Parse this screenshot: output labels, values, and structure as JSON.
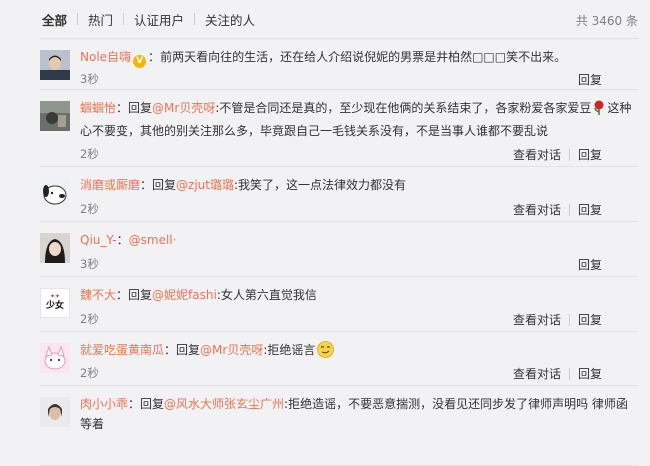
{
  "tabs": [
    "全部",
    "热门",
    "认证用户",
    "关注的人"
  ],
  "total": "共 3460 条",
  "actions": {
    "view_convo": "查看对话",
    "reply": "回复"
  },
  "comments": [
    {
      "user": "Nole自嗨",
      "colon": "：",
      "text": "前两天看向往的生活，还在给人介绍说倪妮的男票是井柏然□□□笑不出来。",
      "time": "3秒"
    },
    {
      "user": "蝈蝈怡",
      "colon": "：回复",
      "mention": "@Mr贝壳呀",
      "text": ":不管是合同还是真的，至少现在他俩的关系结束了，各家粉爱各家爱豆",
      "text2": "这种心不要变，其他的别关注那么多，毕竟跟自己一毛钱关系没有，不是当事人谁都不要乱说",
      "time": "2秒"
    },
    {
      "user": "消磨或厮磨",
      "colon": "：回复",
      "mention": "@zjut璐璐",
      "text": ":我笑了，这一点法律效力都没有",
      "time": "2秒"
    },
    {
      "user": "Qiu_Y-",
      "colon": "：",
      "mention": "@smell·",
      "time": "3秒"
    },
    {
      "user": "魏不大",
      "colon": "：回复",
      "mention": "@妮妮fashi",
      "text": ":女人第六直觉我信",
      "avatar_text": "少女",
      "time": "2秒"
    },
    {
      "user": "就爱吃蛋黄南瓜",
      "colon": "：回复",
      "mention": "@Mr贝壳呀",
      "text": ":拒绝谣言",
      "time": "2秒"
    },
    {
      "user": "肉小小乖",
      "colon": "：回复",
      "mention": "@风水大师张玄尘广州",
      "text": ":拒绝造谣，不要恶意揣测，没看见还同步发了律师声明吗 律师函等着"
    }
  ]
}
